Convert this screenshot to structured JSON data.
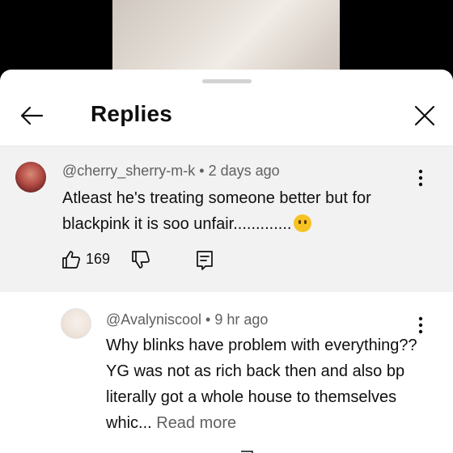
{
  "header": {
    "title": "Replies"
  },
  "comment": {
    "author": "@cherry_sherry-m-k",
    "separator": " • ",
    "time": "2 days ago",
    "text": "Atleast he's treating someone better but for blackpink it is soo unfair.............",
    "likes": "169"
  },
  "reply": {
    "author": "@Avalyniscool",
    "separator": " • ",
    "time": "9 hr ago",
    "text": "Why blinks have problem with everything?? YG was not as rich back then and also bp literally got a whole house to themselves whic...",
    "read_more": " Read more"
  },
  "icons": {
    "back": "arrow-left-icon",
    "close": "close-icon",
    "menu": "more-vert-icon",
    "like": "thumbs-up-icon",
    "dislike": "thumbs-down-icon",
    "reply": "reply-comment-icon",
    "emoji": "melting-face-emoji"
  }
}
